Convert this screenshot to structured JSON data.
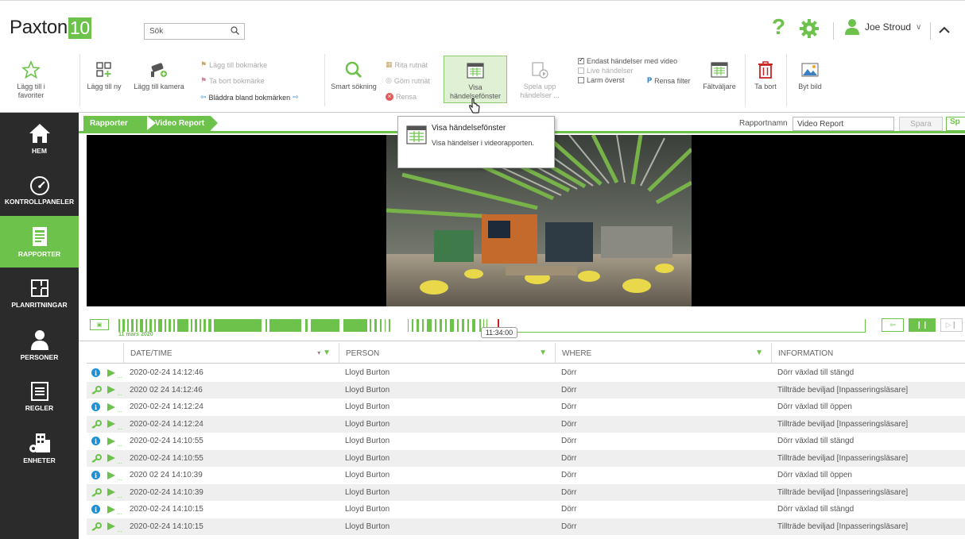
{
  "header": {
    "brand": "Paxton",
    "version": "10",
    "search_placeholder": "Sök",
    "help_label": "?",
    "user_name": "Joe Stroud"
  },
  "ribbon": {
    "favorites": "Lägg till i favoriter",
    "add_new": "Lägg till ny",
    "add_camera": "Lägg till kamera",
    "add_bookmark": "Lägg till bokmärke",
    "remove_bookmark": "Ta bort bokmärke",
    "browse_bookmarks": "Bläddra bland bokmärken",
    "smart_search": "Smart sökning",
    "draw_grid": "Rita rutnät",
    "hide_grid": "Göm rutnät",
    "clear": "Rensa",
    "show_event_window": "Visa händelsefönster",
    "play_events": "Spela upp händelser ...",
    "only_events_with_video": "Endast händelser med video",
    "live_events": "Live händelser",
    "alarms_top": "Larm överst",
    "clear_filter": "Rensa filter",
    "field_picker": "Fältväljare",
    "delete": "Ta bort",
    "change_image": "Byt bild"
  },
  "sidebar": [
    {
      "label": "HEM",
      "icon": "home-icon"
    },
    {
      "label": "KONTROLLPANELER",
      "icon": "dashboard-gauge-icon"
    },
    {
      "label": "RAPPORTER",
      "icon": "reports-icon",
      "active": true
    },
    {
      "label": "PLANRITNINGAR",
      "icon": "floorplan-icon"
    },
    {
      "label": "PERSONER",
      "icon": "person-icon"
    },
    {
      "label": "REGLER",
      "icon": "rules-list-icon"
    },
    {
      "label": "ENHETER",
      "icon": "devices-building-icon"
    }
  ],
  "breadcrumb": [
    "Rapporter",
    "Video Report"
  ],
  "report_name": {
    "label": "Rapportnamn",
    "value": "Video Report",
    "save": "Spara",
    "more": "Sp"
  },
  "tooltip": {
    "title": "Visa händelsefönster",
    "description": "Visa händelser i videorapporten."
  },
  "timeline": {
    "date": "11 mars 2020",
    "current_time": "11:34:00"
  },
  "table": {
    "columns": [
      "DATE/TIME",
      "PERSON",
      "WHERE",
      "INFORMATION"
    ],
    "rows": [
      {
        "type": "info",
        "datetime": "2020-02-24 14:12:46",
        "person": "Lloyd Burton",
        "where": "Dörr",
        "info": "Dörr växlad till stängd"
      },
      {
        "type": "key",
        "datetime": "2020 02 24 14:12:46",
        "person": "Lloyd Burton",
        "where": "Dörr",
        "info": "Tillträde beviljad [Inpasseringsläsare]"
      },
      {
        "type": "info",
        "datetime": "2020-02-24 14:12:24",
        "person": "Lloyd Burton",
        "where": "Dörr",
        "info": "Dörr växlad till öppen"
      },
      {
        "type": "key",
        "datetime": "2020-02-24 14:12:24",
        "person": "Lloyd Burton",
        "where": "Dörr",
        "info": "Tillträde beviljad [Inpasseringsläsare]"
      },
      {
        "type": "info",
        "datetime": "2020-02-24 14:10:55",
        "person": "Lloyd Burton",
        "where": "Dörr",
        "info": "Dörr växlad till stängd"
      },
      {
        "type": "key",
        "datetime": "2020-02-24 14:10:55",
        "person": "Lloyd Burton",
        "where": "Dörr",
        "info": "Tillträde beviljad [Inpasseringsläsare]"
      },
      {
        "type": "info",
        "datetime": "2020 02 24 14:10:39",
        "person": "Lloyd Burton",
        "where": "Dörr",
        "info": "Dörr växlad till öppen"
      },
      {
        "type": "key",
        "datetime": "2020-02-24 14:10:39",
        "person": "Lloyd Burton",
        "where": "Dörr",
        "info": "Tillträde beviljad [Inpasseringsläsare]"
      },
      {
        "type": "info",
        "datetime": "2020-02-24 14:10:15",
        "person": "Lloyd Burton",
        "where": "Dörr",
        "info": "Dörr växlad till stängd"
      },
      {
        "type": "key",
        "datetime": "2020-02-24 14:10:15",
        "person": "Lloyd Burton",
        "where": "Dörr",
        "info": "Tillträde beviljad [Inpasseringsläsare]"
      }
    ]
  },
  "colors": {
    "accent": "#6cc24a",
    "sidebar": "#2b2b2b",
    "info": "#1e90d6",
    "alarm": "#cc2222"
  }
}
